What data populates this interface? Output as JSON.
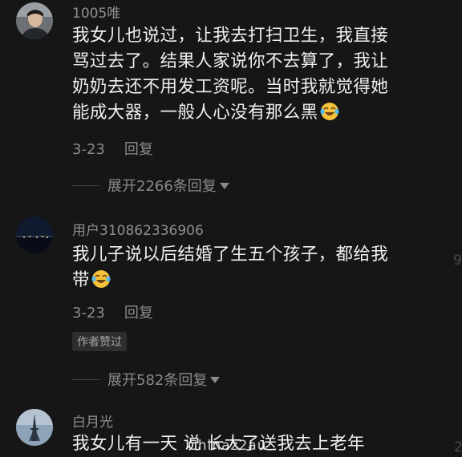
{
  "comments": [
    {
      "username": "1005唯",
      "avatar": "user-portrait-avatar",
      "lines": [
        "我女儿也说过，让我去打扫卫生，我直接",
        "骂过去了。结果人家说你不去算了，我让",
        "奶奶去还不用发工资呢。当时我就觉得她",
        "能成大器，一般人心没有那么黑"
      ],
      "emoji": "laughing-tears-emoji",
      "date": "3-23",
      "reply_label": "回复",
      "expand_label": "展开2266条回复"
    },
    {
      "username": "用户310862336906",
      "avatar": "night-city-avatar",
      "lines": [
        "我儿子说以后结婚了生五个孩子，都给我",
        "带"
      ],
      "emoji": "laughing-tears-emoji",
      "date": "3-23",
      "reply_label": "回复",
      "badge": "作者赞过",
      "expand_label": "展开582条回复"
    },
    {
      "username": "白月光",
      "avatar": "eiffel-tower-avatar",
      "lines": [
        "我女儿有一天 说 长大了送我去上老年"
      ]
    }
  ],
  "edge_glyphs": [
    "9",
    "2"
  ],
  "watermark": "Chinaz2au",
  "colors": {
    "background": "#161616",
    "text_primary": "#f0f0f0",
    "text_secondary": "#8a8a8a",
    "badge_bg": "#2e2e2e"
  }
}
